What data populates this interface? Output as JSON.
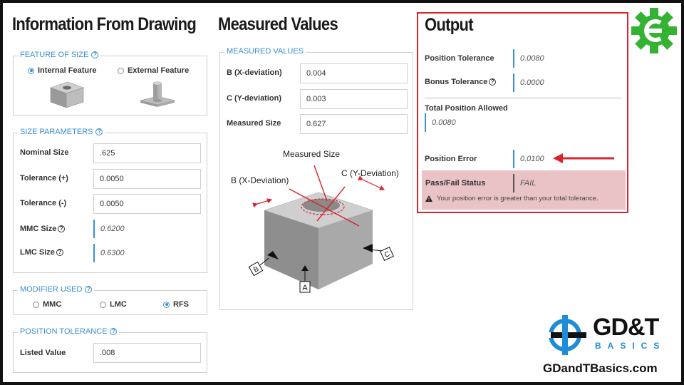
{
  "drawing": {
    "title": "Information From Drawing",
    "feature_of_size": {
      "legend": "FEATURE OF SIZE",
      "internal_label": "Internal Feature",
      "external_label": "External Feature",
      "selected": "internal"
    },
    "size_parameters": {
      "legend": "SIZE PARAMETERS",
      "nominal_label": "Nominal Size",
      "nominal_value": ".625",
      "tol_plus_label": "Tolerance (+)",
      "tol_plus_value": "0.0050",
      "tol_minus_label": "Tolerance (-)",
      "tol_minus_value": "0.0050",
      "mmc_label": "MMC Size",
      "mmc_value": "0.6200",
      "lmc_label": "LMC Size",
      "lmc_value": "0.6300"
    },
    "modifier": {
      "legend": "MODIFIER USED",
      "options": [
        "MMC",
        "LMC",
        "RFS"
      ],
      "selected": "RFS"
    },
    "position_tolerance": {
      "legend": "POSITION TOLERANCE",
      "listed_label": "Listed Value",
      "listed_value": ".008"
    }
  },
  "measured": {
    "title": "Measured Values",
    "legend": "MEASURED VALUES",
    "b_label": "B (X-deviation)",
    "b_value": "0.004",
    "c_label": "C (Y-deviation)",
    "c_value": "0.003",
    "size_label": "Measured Size",
    "size_value": "0.627",
    "diagram": {
      "measured_size": "Measured Size",
      "b_dev": "B (X-Deviation)",
      "c_dev": "C (Y-Deviation)",
      "datum_a": "A",
      "datum_b": "B",
      "datum_c": "C"
    }
  },
  "output": {
    "title": "Output",
    "pos_tol_label": "Position Tolerance",
    "pos_tol_value": "0.0080",
    "bonus_label": "Bonus Tolerance",
    "bonus_value": "0.0000",
    "total_label": "Total Position Allowed",
    "total_value": "0.0080",
    "error_label": "Position Error",
    "error_value": "0.0100",
    "status_label": "Pass/Fail Status",
    "status_value": "FAIL",
    "status_message": "Your position error is greater than your total tolerance."
  },
  "branding": {
    "logo_text": "GD&T",
    "logo_sub": "BASICS",
    "website": "GDandTBasics.com"
  },
  "colors": {
    "accent": "#3a8fd4",
    "fail_bg": "#e9c3c6",
    "output_border": "#d9232d",
    "gear": "#34b233",
    "logo_blue": "#1f8dd6"
  }
}
